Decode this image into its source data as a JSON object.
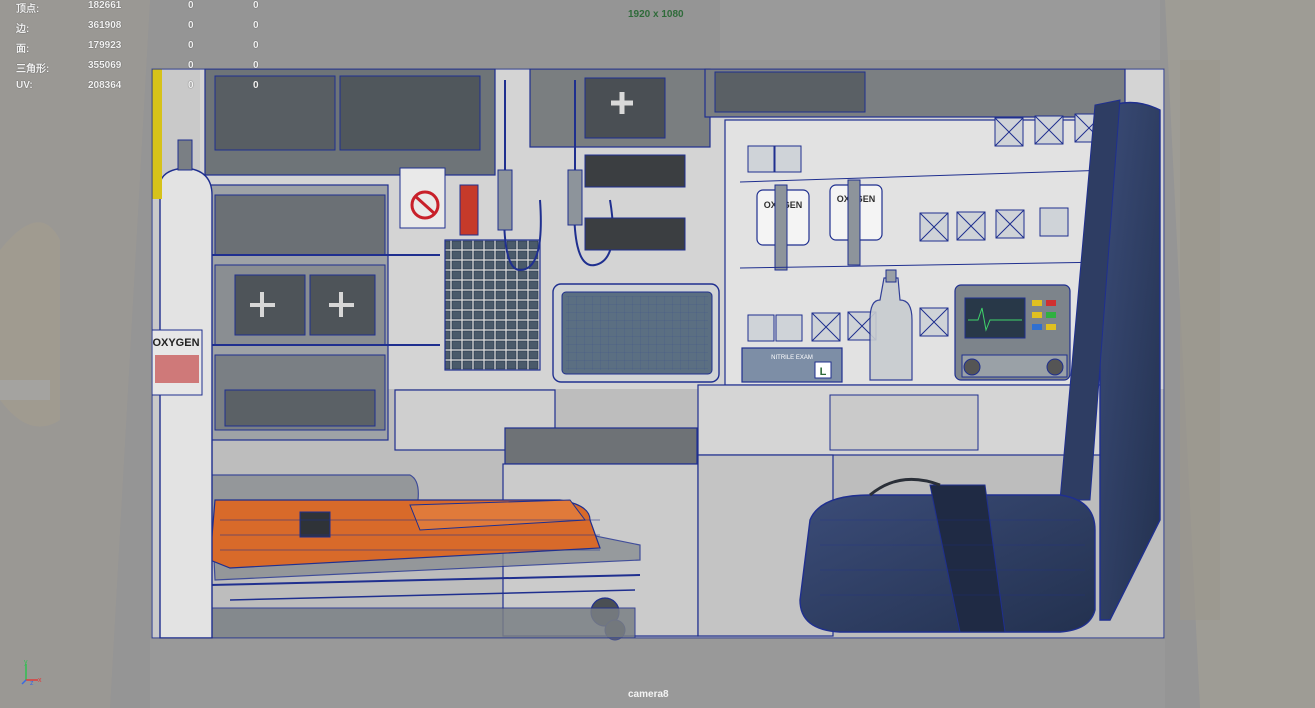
{
  "heads_up": {
    "rows": [
      {
        "label": "顶点:",
        "total": "182661",
        "selected": "0",
        "selected_uv": "0"
      },
      {
        "label": "边:",
        "total": "361908",
        "selected": "0",
        "selected_uv": "0"
      },
      {
        "label": "面:",
        "total": "179923",
        "selected": "0",
        "selected_uv": "0"
      },
      {
        "label": "三角形:",
        "total": "355069",
        "selected": "0",
        "selected_uv": "0"
      },
      {
        "label": "UV:",
        "total": "208364",
        "selected": "0",
        "selected_uv": "0"
      }
    ]
  },
  "resolution_gate": "1920 x 1080",
  "camera_name": "camera8",
  "axis_indicator": {
    "x": "x",
    "y": "y",
    "z": "z"
  },
  "scene": {
    "oxygen_tank_label": "OXYGEN",
    "oxygen_outlet_1": "OXYGEN",
    "oxygen_outlet_2": "OXYGEN",
    "glove_box_label": "L",
    "glove_box_text": "NITRILE EXAM"
  },
  "colors": {
    "wireframe": "#1f2f8f",
    "stretcher": "#d86a2a",
    "seat": "#2f3f66",
    "hud_text": "#f2f2f2",
    "resolution_text": "#2f6b3a"
  }
}
